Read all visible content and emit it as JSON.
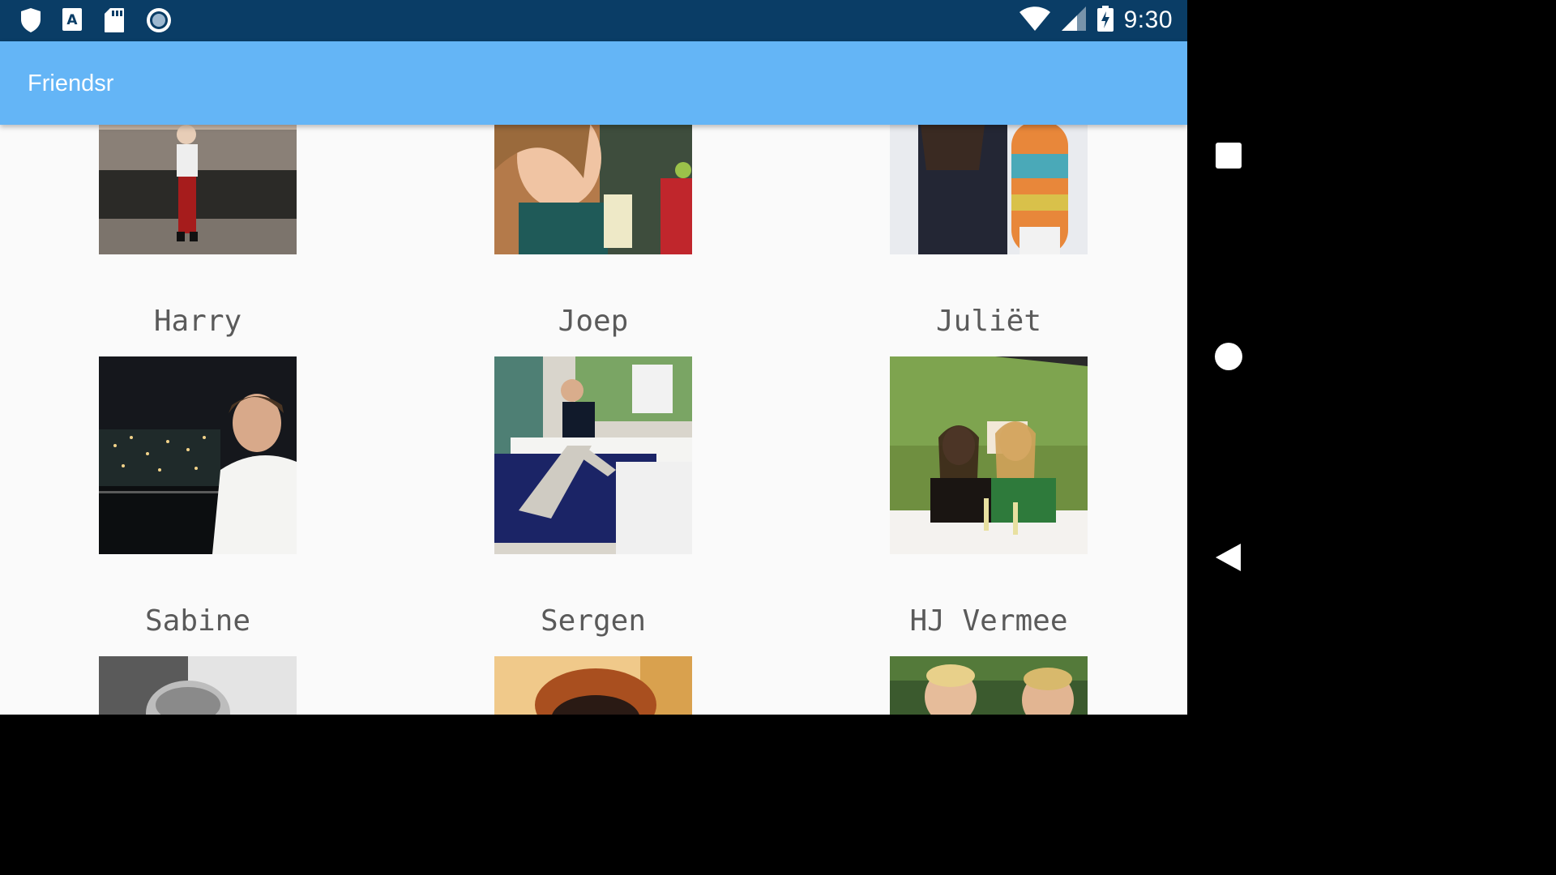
{
  "status_bar": {
    "time": "9:30",
    "left_icons": [
      "shield-icon",
      "keyboard-a-icon",
      "sd-card-icon",
      "record-icon"
    ],
    "right_icons": [
      "wifi-icon",
      "cell-signal-icon",
      "battery-charging-icon"
    ],
    "background": "#0a3d66"
  },
  "app_bar": {
    "title": "Friendsr",
    "color": "#64b5f6"
  },
  "friends": [
    {
      "name": "",
      "photo": "photo-girl-canal"
    },
    {
      "name": "",
      "photo": "photo-girl-drink"
    },
    {
      "name": "",
      "photo": "photo-snowboard"
    },
    {
      "name": "Harry",
      "photo": "photo-man-night-city"
    },
    {
      "name": "Joep",
      "photo": "photo-man-bed"
    },
    {
      "name": "Juliët",
      "photo": "photo-two-girls-dinner"
    },
    {
      "name": "Sabine",
      "photo": "photo-bw-portrait"
    },
    {
      "name": "Sergen",
      "photo": "photo-redhair"
    },
    {
      "name": "HJ Vermee",
      "photo": "photo-two-boys"
    }
  ],
  "nav_bar": {
    "buttons": [
      "recents-button",
      "home-button",
      "back-button"
    ]
  }
}
